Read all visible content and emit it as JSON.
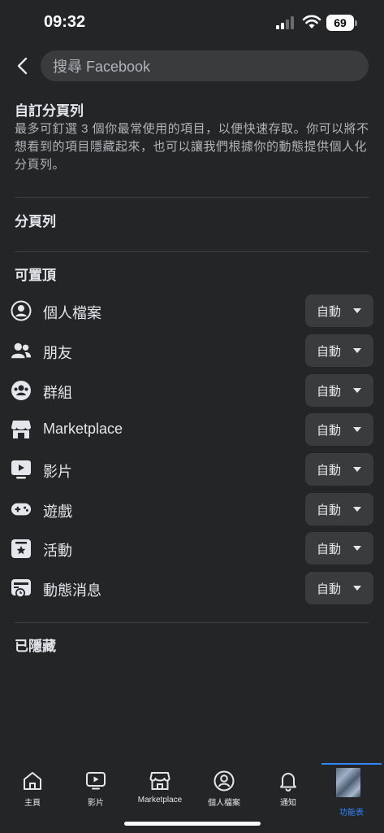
{
  "status_bar": {
    "time": "09:32",
    "battery": "69"
  },
  "search": {
    "placeholder": "搜尋 Facebook"
  },
  "header": {
    "title": "自訂分頁列",
    "description": "最多可釘選 3 個你最常使用的項目，以便快速存取。你可以將不想看到的項目隱藏起來，也可以讓我們根據你的動態提供個人化分頁列。"
  },
  "sections": {
    "tab_bar": "分頁列",
    "pinnable": "可置頂",
    "hidden": "已隱藏"
  },
  "items": [
    {
      "label": "個人檔案",
      "icon": "profile-icon",
      "value": "自動"
    },
    {
      "label": "朋友",
      "icon": "friends-icon",
      "value": "自動"
    },
    {
      "label": "群組",
      "icon": "groups-icon",
      "value": "自動"
    },
    {
      "label": "Marketplace",
      "icon": "marketplace-icon",
      "value": "自動"
    },
    {
      "label": "影片",
      "icon": "video-icon",
      "value": "自動"
    },
    {
      "label": "遊戲",
      "icon": "gaming-icon",
      "value": "自動"
    },
    {
      "label": "活動",
      "icon": "events-icon",
      "value": "自動"
    },
    {
      "label": "動態消息",
      "icon": "feeds-icon",
      "value": "自動"
    }
  ],
  "bottom_tabs": [
    {
      "label": "主頁",
      "icon": "home-icon"
    },
    {
      "label": "影片",
      "icon": "video-icon"
    },
    {
      "label": "Marketplace",
      "icon": "marketplace-icon"
    },
    {
      "label": "個人檔案",
      "icon": "profile-icon"
    },
    {
      "label": "通知",
      "icon": "bell-icon"
    },
    {
      "label": "功能表",
      "icon": "avatar"
    }
  ],
  "colors": {
    "background": "#242526",
    "surface": "#3a3b3c",
    "accent": "#2d88ff",
    "text": "#e4e6eb",
    "secondary_text": "#b0b3b8"
  }
}
